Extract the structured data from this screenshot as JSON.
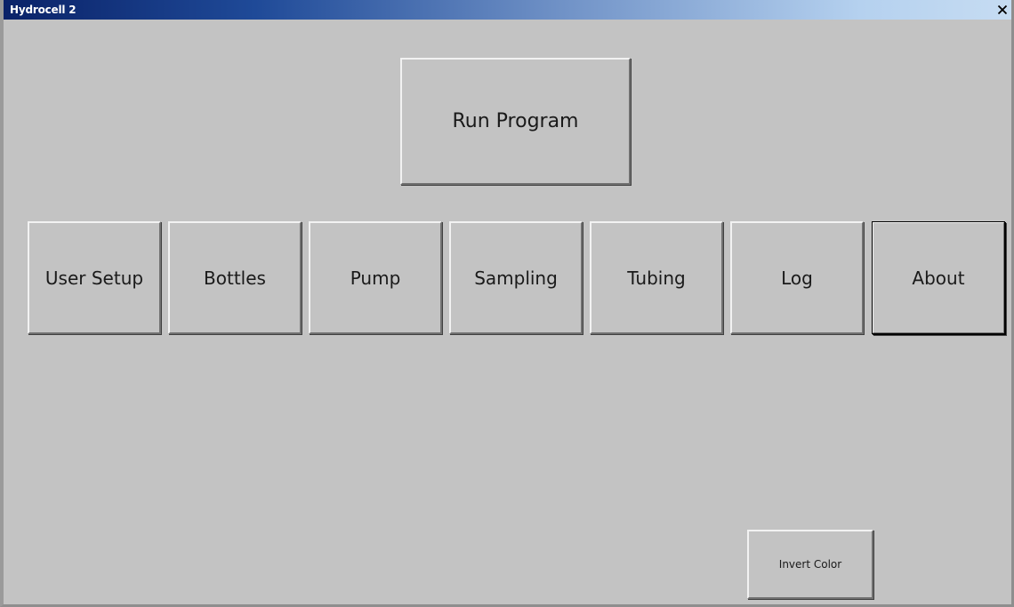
{
  "window": {
    "title": "Hydrocell 2",
    "close_glyph": "close-icon"
  },
  "main": {
    "run_program_label": "Run Program",
    "nav_buttons": [
      {
        "label": "User Setup"
      },
      {
        "label": "Bottles"
      },
      {
        "label": "Pump"
      },
      {
        "label": "Sampling"
      },
      {
        "label": "Tubing"
      },
      {
        "label": "Log"
      },
      {
        "label": "About",
        "focused": true
      }
    ],
    "invert_color_label": "Invert Color"
  },
  "colors": {
    "background": "#c3c3c3",
    "titlebar_start": "#0a2268",
    "titlebar_end": "#c6dcf2",
    "text": "#1a1a1a"
  }
}
